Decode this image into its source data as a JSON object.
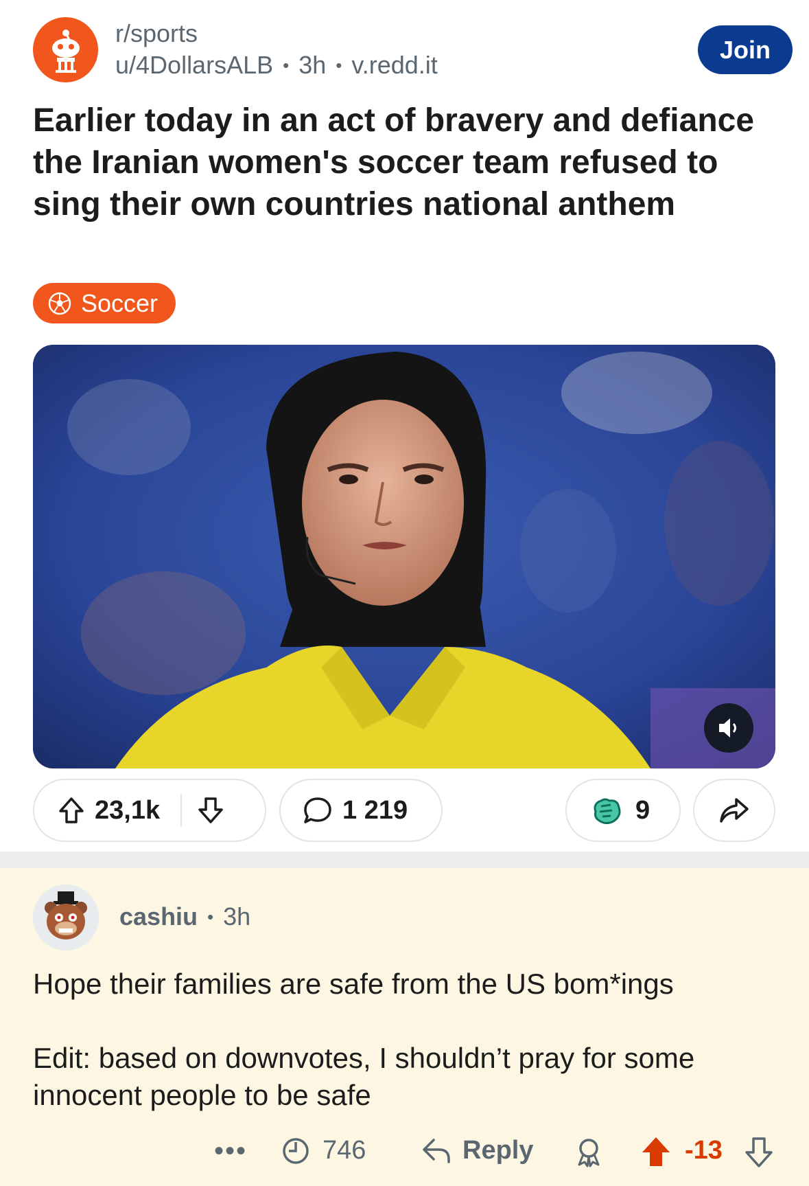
{
  "post": {
    "subreddit": "r/sports",
    "author": "u/4DollarsALB",
    "age": "3h",
    "domain": "v.redd.it",
    "join_label": "Join",
    "title": "Earlier today in an act of bravery and defiance the Iranian women's soccer team refused to sing their own countries national anthem",
    "flair": "Soccer",
    "votes": "23,1k",
    "comments": "1 219",
    "awards": "9"
  },
  "comment": {
    "username": "cashiu",
    "age": "3h",
    "body_line1": "Hope their families are safe from the US bom*ings",
    "body_line2": "Edit: based on downvotes, I shouldn’t pray for some innocent people to be safe",
    "more": "•••",
    "views": "746",
    "reply_label": "Reply",
    "score": "-13"
  },
  "colors": {
    "accent": "#f1561c",
    "join": "#0a3b91",
    "downvoted_score": "#d93a00",
    "comment_bg": "#fcf6e3"
  },
  "icons": [
    "subreddit-avatar-icon",
    "soccer-ball-icon",
    "sound-toggle-icon",
    "upvote-icon",
    "downvote-icon",
    "comment-icon",
    "award-icon",
    "share-icon",
    "user-avatar-icon",
    "views-icon",
    "reply-icon",
    "award-outline-icon"
  ]
}
